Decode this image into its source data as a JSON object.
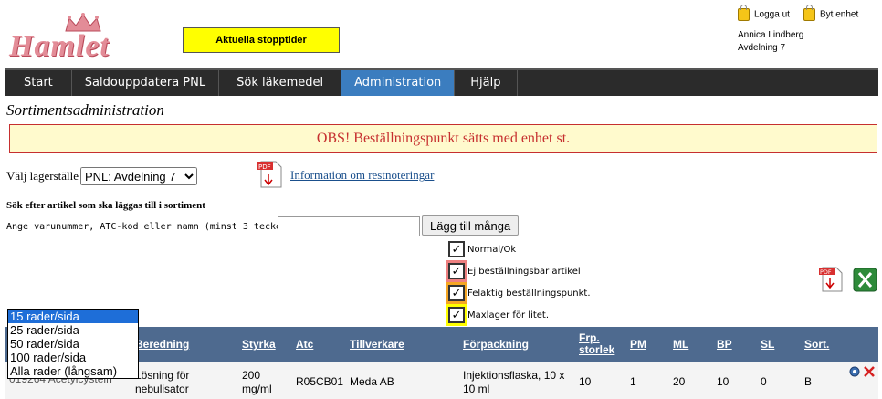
{
  "header": {
    "logo_text": "Hamlet",
    "stopp_button": "Aktuella stopptider",
    "logout": "Logga ut",
    "switch_unit": "Byt enhet",
    "user_name": "Annica Lindberg",
    "department": "Avdelning 7"
  },
  "nav": {
    "items": [
      "Start",
      "Saldouppdatera PNL",
      "Sök läkemedel",
      "Administration",
      "Hjälp"
    ],
    "active": "Administration"
  },
  "page": {
    "title": "Sortimentsadministration",
    "notice": "OBS! Beställningspunkt sätts med enhet st.",
    "storage_label": "Välj lagerställe",
    "storage_value": "PNL: Avdelning 7",
    "info_link": "Information om restnoteringar",
    "search_heading": "Sök efter artikel som ska läggas till i sortiment",
    "search_label": "Ange varunummer, ATC-kod eller namn (minst 3 tecken):",
    "search_value": "",
    "add_many_button": "Lägg till många"
  },
  "legend": [
    {
      "label": "Normal/Ok",
      "color": "#ffffff"
    },
    {
      "label": "Ej beställningsbar artikel",
      "color": "#ee8080"
    },
    {
      "label": "Felaktig beställningspunkt.",
      "color": "#f5a623"
    },
    {
      "label": "Maxlager för litet.",
      "color": "#ffff00"
    }
  ],
  "rows_per_page": {
    "options": [
      "15 rader/sida",
      "25 rader/sida",
      "50 rader/sida",
      "100 rader/sida",
      "Alla rader (långsam)"
    ],
    "selected": "15 rader/sida"
  },
  "table": {
    "columns": [
      "Beredning",
      "Styrka",
      "Atc",
      "Tillverkare",
      "Förpackning",
      "Frp. storlek",
      "PM",
      "ML",
      "BP",
      "SL",
      "Sort."
    ],
    "rows": [
      {
        "partial_id": "019264",
        "partial_name": "Acetylcystein",
        "beredning": "Lösning för nebulisator",
        "styrka": "200 mg/ml",
        "atc": "R05CB01",
        "tillverkare": "Meda AB",
        "forpackning": "Injektionsflaska, 10 x 10 ml",
        "frp_storlek": "10",
        "pm": "1",
        "ml": "20",
        "bp": "10",
        "sl": "0",
        "sort": "B"
      }
    ]
  }
}
